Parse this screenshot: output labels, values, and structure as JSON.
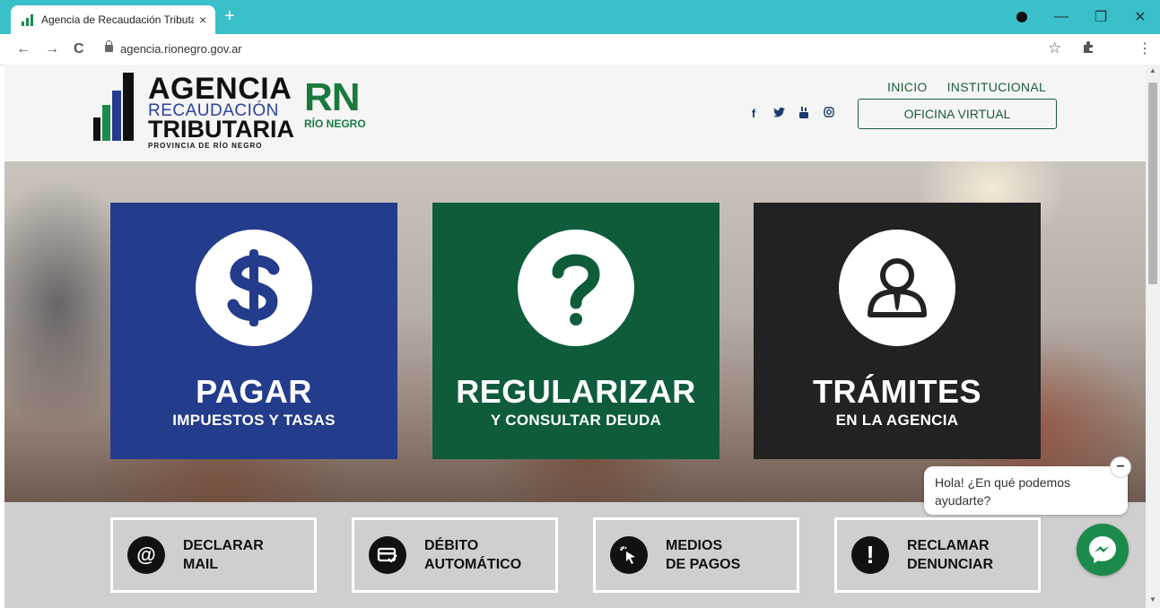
{
  "browser": {
    "tab_title": "Agencia de Recaudación Tributar",
    "close_glyph": "×",
    "new_tab_glyph": "+",
    "url": "agencia.rionegro.gov.ar",
    "win_min": "—",
    "win_max": "❐",
    "win_close": "✕",
    "back": "←",
    "forward": "→",
    "reload": "C",
    "star": "☆",
    "menu": "⋮"
  },
  "header": {
    "logo": {
      "line1": "AGENCIA",
      "line2": "RECAUDACIÓN",
      "line3": "TRIBUTARIA",
      "line4": "PROVINCIA DE RÍO NEGRO"
    },
    "rn_logo": {
      "mark": "RN",
      "sub": "RÍO NEGRO"
    },
    "social": [
      "f",
      "t",
      "yt",
      "ig"
    ],
    "nav": {
      "inicio": "INICIO",
      "institucional": "INSTITUCIONAL"
    },
    "oficina_virtual": "OFICINA VIRTUAL"
  },
  "cards": [
    {
      "title": "PAGAR",
      "subtitle": "IMPUESTOS Y TASAS",
      "icon": "dollar-icon",
      "color": "#243c8c"
    },
    {
      "title": "REGULARIZAR",
      "subtitle": "Y CONSULTAR DEUDA",
      "icon": "question-icon",
      "color": "#0f5c3b"
    },
    {
      "title": "TRÁMITES",
      "subtitle": "EN LA AGENCIA",
      "icon": "person-icon",
      "color": "#222222"
    }
  ],
  "quick_links": [
    {
      "line1": "DECLARAR",
      "line2": "MAIL",
      "icon": "at-icon"
    },
    {
      "line1": "DÉBITO",
      "line2": "AUTOMÁTICO",
      "icon": "card-icon"
    },
    {
      "line1": "MEDIOS",
      "line2": "DE PAGOS",
      "icon": "cursor-icon"
    },
    {
      "line1": "RECLAMAR",
      "line2": "DENUNCIAR",
      "icon": "exclamation-icon"
    }
  ],
  "chat": {
    "message_line1": "Hola! ¿En qué podemos",
    "message_line2": "ayudarte?",
    "minimize": "−"
  }
}
